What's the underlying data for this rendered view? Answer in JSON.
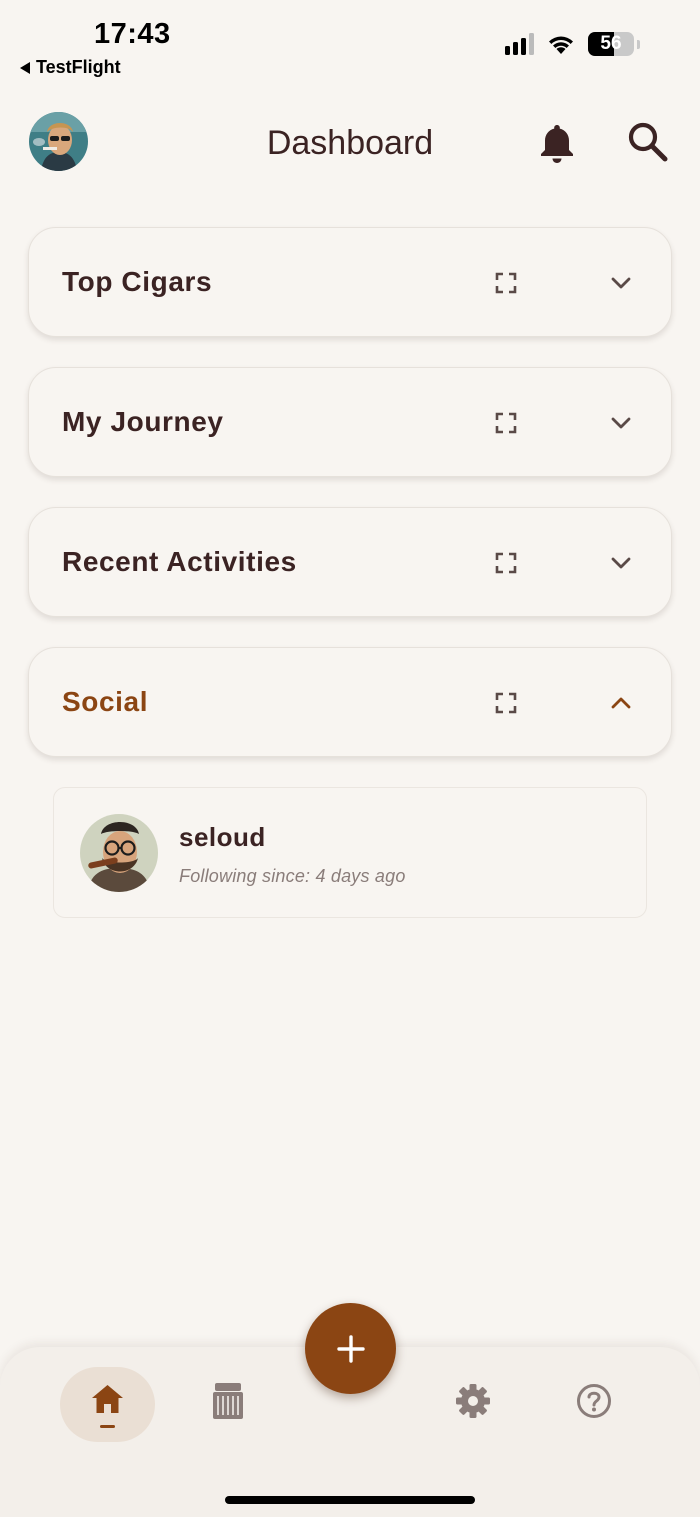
{
  "status_bar": {
    "time": "17:43",
    "back_label": "TestFlight",
    "battery_level": "56",
    "icons": [
      "cellular-signal-icon",
      "wifi-icon",
      "battery-icon"
    ]
  },
  "header": {
    "title": "Dashboard",
    "avatar": "profile-avatar",
    "icons": [
      "bell-icon",
      "search-icon"
    ]
  },
  "sections": [
    {
      "title": "Top Cigars",
      "expanded": false
    },
    {
      "title": "My Journey",
      "expanded": false
    },
    {
      "title": "Recent Activities",
      "expanded": false
    },
    {
      "title": "Social",
      "expanded": true
    }
  ],
  "social": {
    "items": [
      {
        "name": "seloud",
        "since": "Following since: 4 days ago"
      }
    ]
  },
  "bottom_nav": {
    "items": [
      {
        "icon": "home-icon",
        "active": true
      },
      {
        "icon": "humidor-icon",
        "active": false
      },
      {
        "icon": "gear-icon",
        "active": false
      },
      {
        "icon": "help-icon",
        "active": false
      }
    ],
    "fab_icon": "plus-icon"
  },
  "colors": {
    "background": "#f8f5f1",
    "text": "#3b2323",
    "accent": "#8b4513",
    "muted": "#8a7d7a",
    "nav_active_bg": "#eadfd4"
  }
}
